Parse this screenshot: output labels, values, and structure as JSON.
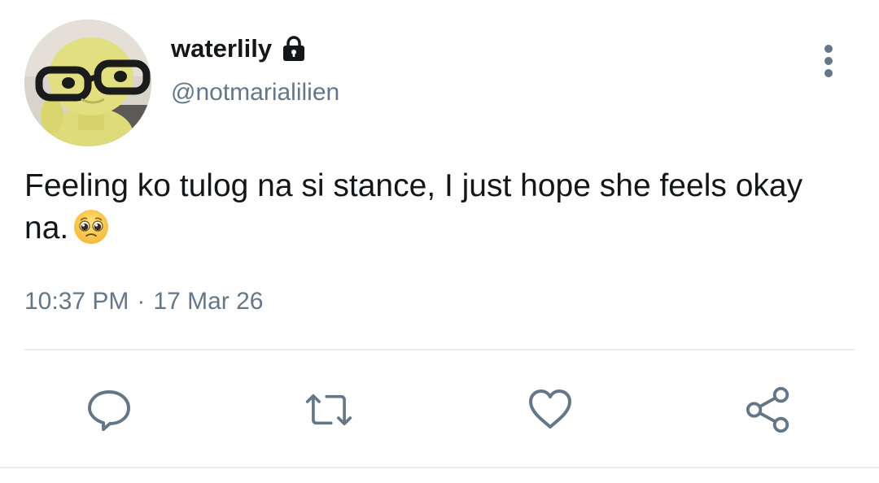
{
  "user": {
    "display_name": "waterlily",
    "handle": "@notmarialilien",
    "protected": true,
    "avatar_icon": "yellow-figure-with-glasses"
  },
  "tweet": {
    "text": "Feeling ko tulog na si stance, I just hope she feels okay na.",
    "emoji": "pleading-face-emoji",
    "time": "10:37 PM",
    "separator": "·",
    "date": "17 Mar 26"
  },
  "actions": [
    {
      "name": "reply",
      "icon": "reply-icon"
    },
    {
      "name": "retweet",
      "icon": "retweet-icon"
    },
    {
      "name": "like",
      "icon": "heart-icon"
    },
    {
      "name": "share",
      "icon": "share-icon"
    }
  ],
  "colors": {
    "text_primary": "#14171a",
    "text_secondary": "#657786",
    "icon": "#657786",
    "divider": "#e6ecf0"
  }
}
